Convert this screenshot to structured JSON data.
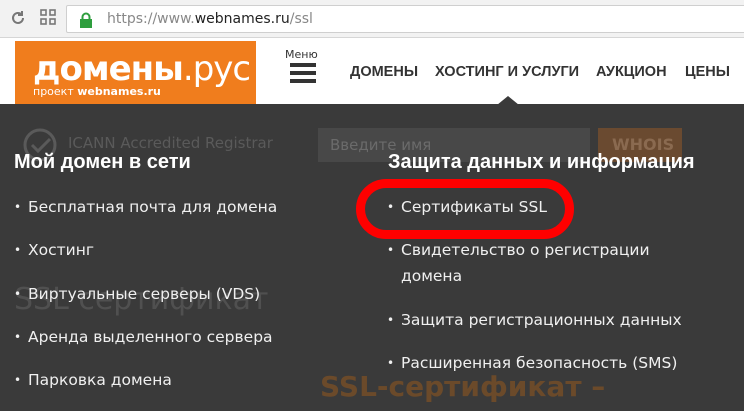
{
  "browser": {
    "url_scheme": "https://www.",
    "url_host": "webnames.ru",
    "url_path": "/ssl"
  },
  "header": {
    "logo_main": "домены",
    "logo_tld": ".рус",
    "logo_sub_prefix": "проект ",
    "logo_sub_brand": "webnames.ru",
    "menu_label": "Меню",
    "nav": [
      "ДОМЕНЫ",
      "ХОСТИНГ И УСЛУГИ",
      "АУКЦИОН",
      "ЦЕНЫ"
    ]
  },
  "background": {
    "registrar_text": "ICANN Accredited Registrar",
    "search_placeholder": "Введите имя",
    "whois_label": "WHOIS",
    "page_title": "SSL сертификат",
    "subtitle": "SSL-сертификат –"
  },
  "dropdown": {
    "left": {
      "title": "Мой домен в сети",
      "items": [
        "Бесплатная почта для домена",
        "Хостинг",
        "Виртуальные серверы (VDS)",
        "Аренда выделенного сервера",
        "Парковка домена"
      ]
    },
    "right": {
      "title": "Защита данных и информация",
      "items": [
        "Сертификаты SSL",
        "Свидетельство о регистрации",
        "домена",
        "Защита регистрационных данных",
        "Расширенная безопасность (SMS)"
      ]
    }
  },
  "colors": {
    "brand_orange": "#f07d1d",
    "dropdown_bg": "#3a3a3a",
    "highlight": "#ff0000"
  }
}
